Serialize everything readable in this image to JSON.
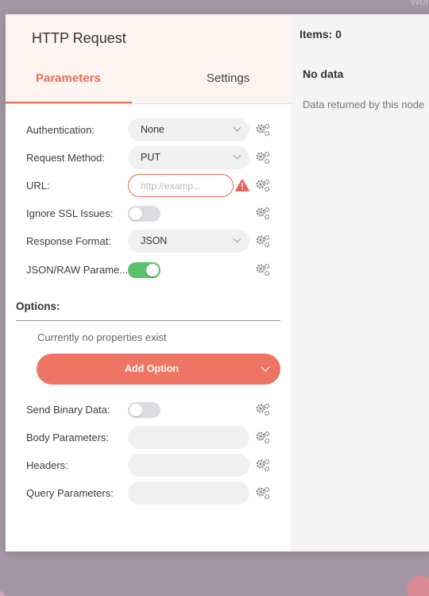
{
  "background": {
    "corner_text": "Wor"
  },
  "node": {
    "title": "HTTP Request"
  },
  "tabs": [
    {
      "label": "Parameters",
      "active": true
    },
    {
      "label": "Settings",
      "active": false
    }
  ],
  "params": {
    "authentication": {
      "label": "Authentication:",
      "value": "None"
    },
    "request_method": {
      "label": "Request Method:",
      "value": "PUT"
    },
    "url": {
      "label": "URL:",
      "placeholder": "http://examp..."
    },
    "ignore_ssl": {
      "label": "Ignore SSL Issues:",
      "enabled": false
    },
    "response_format": {
      "label": "Response Format:",
      "value": "JSON"
    },
    "json_raw": {
      "label": "JSON/RAW Parame...",
      "enabled": true
    },
    "send_binary": {
      "label": "Send Binary Data:",
      "enabled": false
    },
    "body_params": {
      "label": "Body Parameters:"
    },
    "headers": {
      "label": "Headers:"
    },
    "query_params": {
      "label": "Query Parameters:"
    }
  },
  "options": {
    "label": "Options:",
    "empty_text": "Currently no properties exist",
    "add_button": "Add Option"
  },
  "output": {
    "items_count": "Items: 0",
    "no_data_title": "No data",
    "no_data_desc": "Data returned by this node"
  },
  "colors": {
    "accent": "#e8705a",
    "button": "#ee7564",
    "toggle_on": "#5ac26a",
    "warning": "#e8605a"
  }
}
